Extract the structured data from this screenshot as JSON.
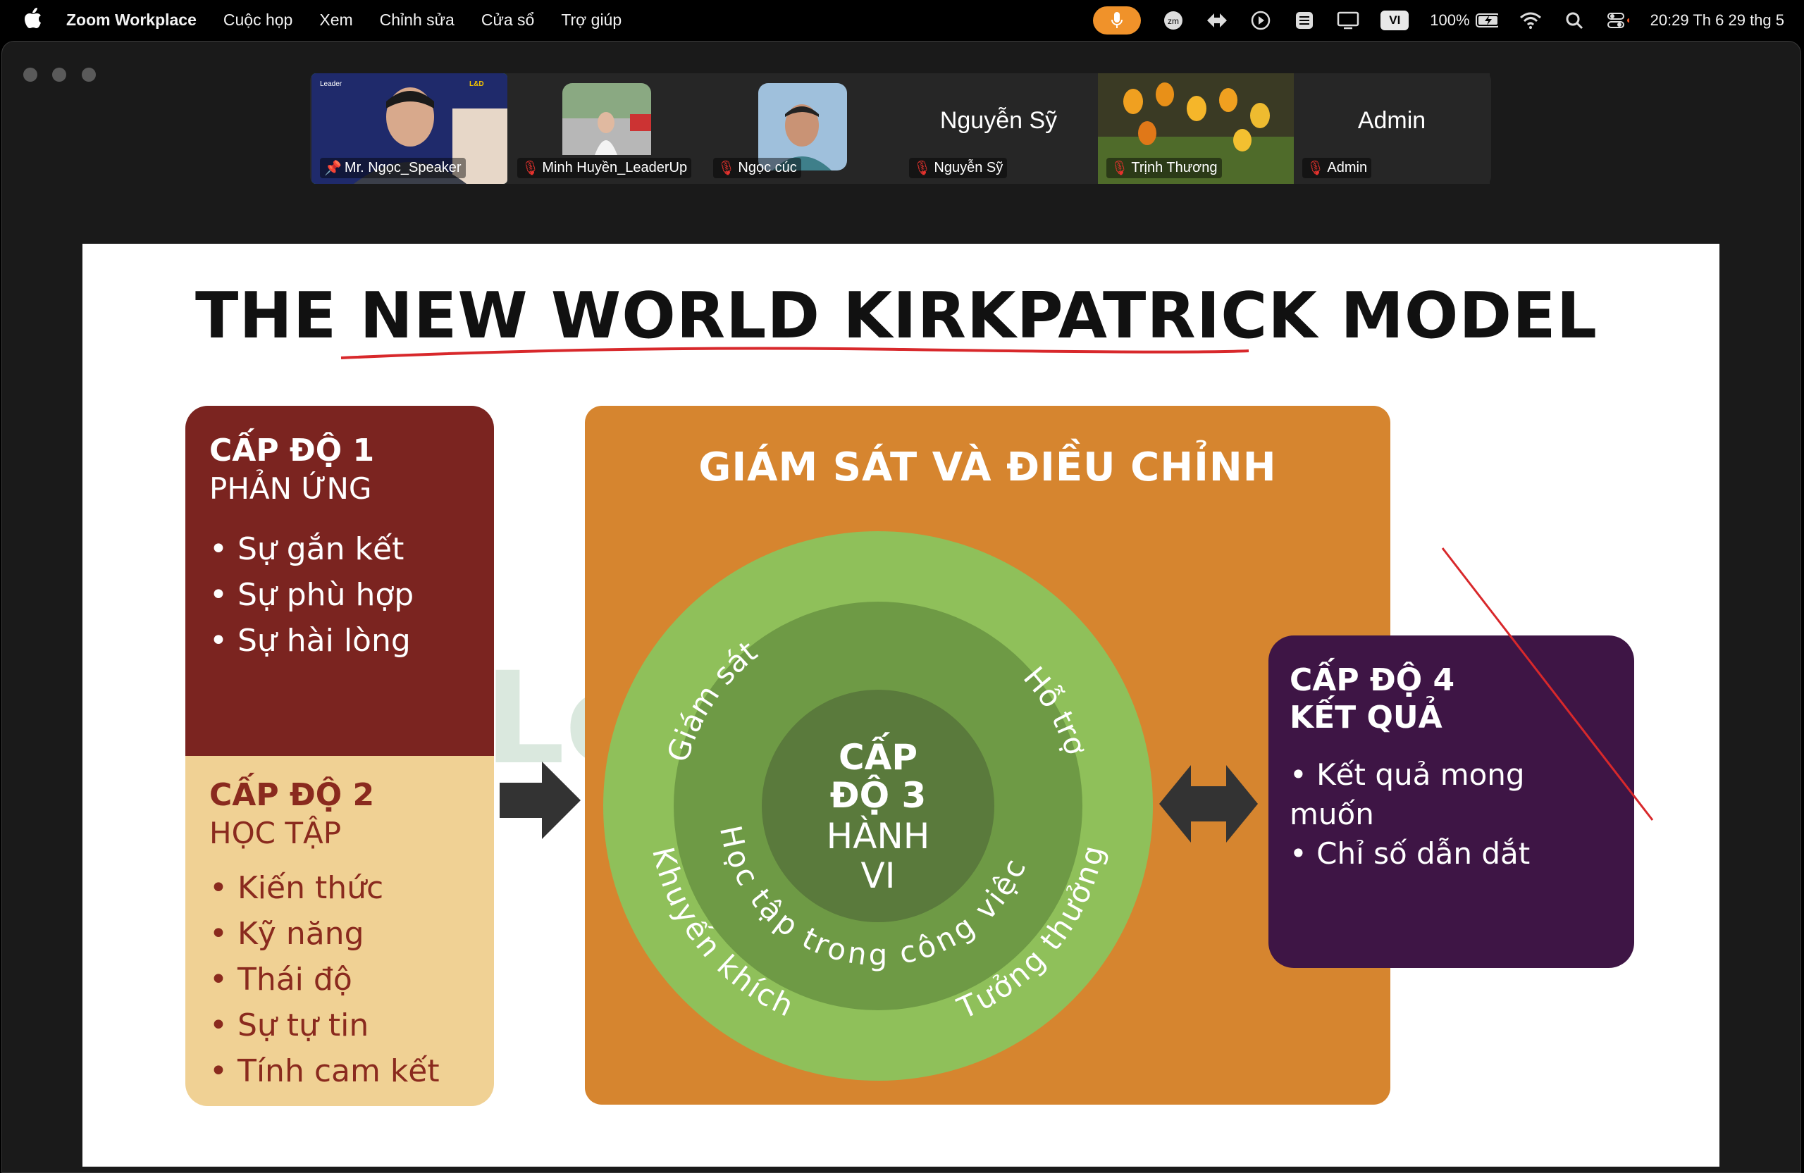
{
  "menubar": {
    "app_name": "Zoom Workplace",
    "menus": [
      "Cuộc họp",
      "Xem",
      "Chỉnh sửa",
      "Cửa sổ",
      "Trợ giúp"
    ],
    "status": {
      "input_badge": "VI",
      "battery": "100%",
      "clock": "20:29 Th 6 29 thg 5"
    }
  },
  "participants": [
    {
      "name": "Mr. Ngọc_Speaker",
      "type": "video",
      "active": true,
      "icon": "pin-icon"
    },
    {
      "name": "Minh Huyền_LeaderUp",
      "type": "photo",
      "icon": "mic-muted-icon"
    },
    {
      "name": "Ngọc cúc",
      "type": "photo",
      "icon": "mic-muted-icon"
    },
    {
      "name": "Nguyễn Sỹ",
      "display": "Nguyễn Sỹ",
      "type": "name",
      "icon": "mic-muted-icon"
    },
    {
      "name": "Trịnh Thương",
      "type": "photo",
      "icon": "mic-muted-icon"
    },
    {
      "name": "Admin",
      "display": "Admin",
      "type": "name",
      "icon": "mic-muted-icon"
    }
  ],
  "slide": {
    "title": "THE NEW WORLD KIRKPATRICK MODEL",
    "level1": {
      "heading": "CẤP ĐỘ 1",
      "subheading": "PHẢN ỨNG",
      "items": [
        "Sự gắn kết",
        "Sự phù hợp",
        "Sự hài lòng"
      ]
    },
    "level2": {
      "heading": "CẤP ĐỘ 2",
      "subheading": "HỌC TẬP",
      "items": [
        "Kiến thức",
        "Kỹ năng",
        "Thái độ",
        "Sự tự tin",
        "Tính cam kết"
      ]
    },
    "center": {
      "title": "GIÁM SÁT VÀ ĐIỀU CHỈNH",
      "outer_ring": [
        "Giám sát",
        "Hỗ trợ",
        "Khuyến khích",
        "Tưởng thưởng"
      ],
      "inner_ring": "Học tập trong công việc",
      "core_line1": "CẤP",
      "core_line2": "ĐỘ 3",
      "core_line3": "HÀNH",
      "core_line4": "VI"
    },
    "level4": {
      "heading_line1": "CẤP ĐỘ 4",
      "heading_line2": "KẾT QUẢ",
      "items": [
        "Kết quả mong muốn",
        "Chỉ số dẫn dắt"
      ]
    },
    "watermark": "Leader"
  },
  "colors": {
    "level1": "#7b2420",
    "level2": "#f0d194",
    "center": "#d6852f",
    "ring_outer": "#8fc05a",
    "ring_mid": "#6e9a45",
    "ring_core": "#5a7a3c",
    "level4": "#3e1545",
    "mic_pill": "#f0922a",
    "active_outline": "#2ecc40"
  }
}
